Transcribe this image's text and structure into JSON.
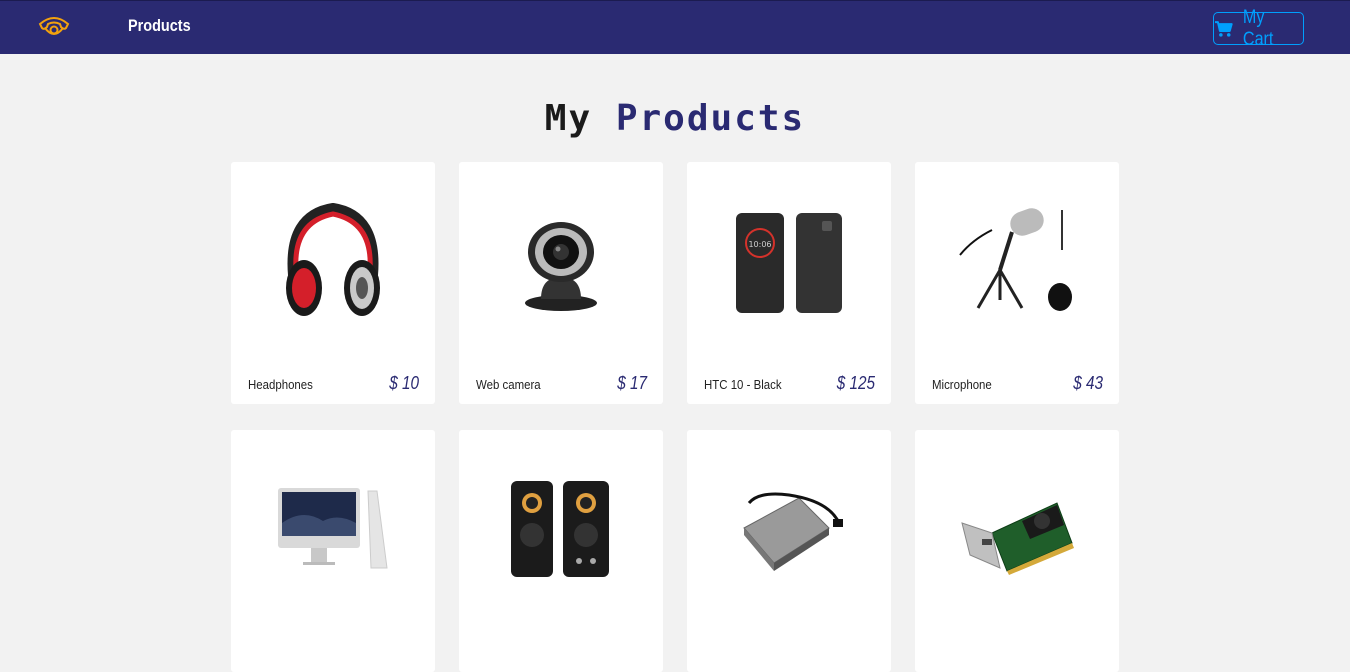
{
  "navbar": {
    "logo_icon": "phone-icon",
    "products_link": "Products",
    "cart_icon": "cart-icon",
    "cart_label": "My Cart"
  },
  "page_title": {
    "part1": "My",
    "part2": "Products"
  },
  "products": [
    {
      "name": "Headphones",
      "price": "$ 10",
      "icon": "headphones-icon"
    },
    {
      "name": "Web camera",
      "price": "$ 17",
      "icon": "webcam-icon"
    },
    {
      "name": "HTC 10 - Black",
      "price": "$ 125",
      "icon": "phone-image-icon"
    },
    {
      "name": "Microphone",
      "price": "$ 43",
      "icon": "microphone-icon"
    },
    {
      "name": "",
      "price": "",
      "icon": "imac-icon"
    },
    {
      "name": "",
      "price": "",
      "icon": "speakers-icon"
    },
    {
      "name": "",
      "price": "",
      "icon": "hard-drive-icon"
    },
    {
      "name": "",
      "price": "",
      "icon": "graphics-card-icon"
    }
  ],
  "colors": {
    "navbar": "#2a2a72",
    "accent": "#009ffd",
    "logo": "#f3a20d",
    "background": "#f2f2f2"
  }
}
